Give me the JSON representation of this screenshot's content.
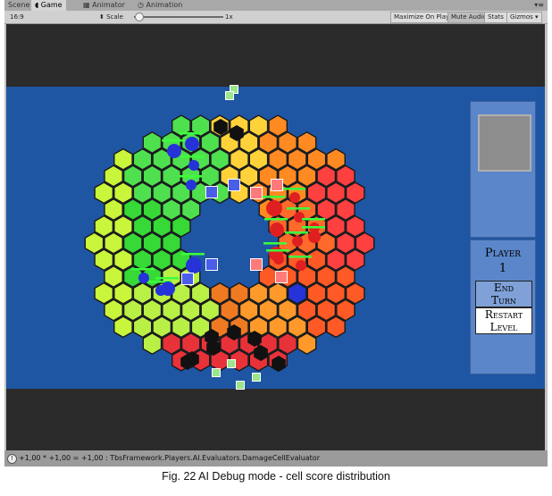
{
  "tabs": [
    {
      "label": "Scene",
      "active": false,
      "icon": "scene-icon"
    },
    {
      "label": "Game",
      "active": true,
      "icon": "game-controller-icon"
    },
    {
      "label": "Animator",
      "active": false,
      "icon": "animator-icon"
    },
    {
      "label": "Animation",
      "active": false,
      "icon": "animation-clock-icon"
    }
  ],
  "toolbar": {
    "aspect": "16:9",
    "scale_label": "Scale",
    "scale_value": "1x",
    "maximize_on_play": "Maximize On Play",
    "mute_audio": "Mute Audio",
    "stats": "Stats",
    "gizmos": "Gizmos"
  },
  "hud": {
    "player_label": "Player",
    "player_number": "1",
    "end_turn": [
      "End",
      "Turn"
    ],
    "restart_level": [
      "Restart",
      "Level"
    ]
  },
  "status_bar": {
    "text": "+1,00 * +1,00 = +1,00 : TbsFramework.Players.AI.Evaluators.DamageCellEvaluator"
  },
  "caption": "Fig. 22 AI Debug mode - cell score distribution",
  "colors": {
    "game_background": "#1f56a3",
    "hud_panel": "#5b86c9",
    "player_blue": "#2533d9",
    "player_red": "#e02020",
    "highlight_magenta": "#e02bd6"
  }
}
